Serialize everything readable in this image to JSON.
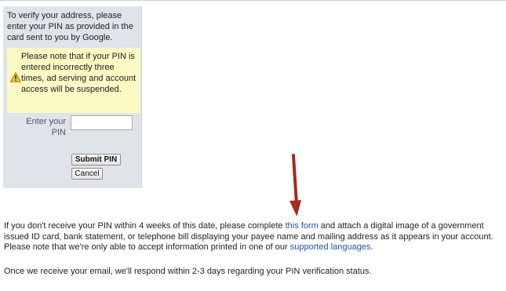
{
  "pin_panel": {
    "instruction": "To verify your address, please enter your PIN as provided in the card sent to you by Google.",
    "warning": "Please note that if your PIN is entered incorrectly three times, ad serving and account access will be suspended.",
    "pin_label": "Enter your PIN",
    "pin_value": "",
    "submit_label": "Submit PIN",
    "cancel_label": "Cancel"
  },
  "info": {
    "part1": "If you don't receive your PIN within 4 weeks of this date, please complete ",
    "form_link": "this form",
    "part2": " and attach a digital image of a government issued ID card, bank statement, or telephone bill displaying your payee name and mailing address as it appears in your account. Please note that we're only able to accept information printed in one of our ",
    "languages_link": "supported languages",
    "part3": "."
  },
  "followup": "Once we receive your email, we'll respond within 2-3 days regarding your PIN verification status.",
  "colors": {
    "panel_bg": "#dfe3ea",
    "warning_bg": "#fbf9c4",
    "link": "#1a55b3",
    "arrow": "#a52a1f"
  },
  "icons": {
    "warning": "warning-triangle-icon",
    "arrow": "down-arrow-icon"
  }
}
